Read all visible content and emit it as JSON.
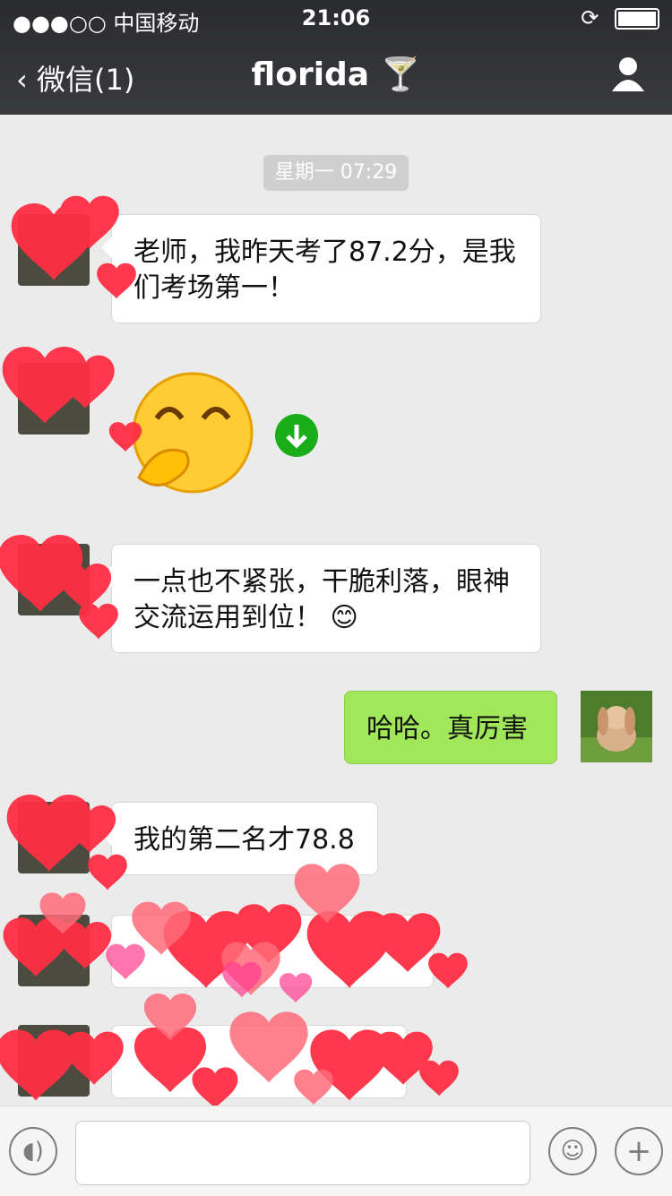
{
  "status_bar": {
    "carrier": "●●●○○ 中国移动",
    "time": "21:06"
  },
  "nav": {
    "back_label": "微信(1)",
    "title": "florida 🍸"
  },
  "chat": {
    "timestamp": "星期一 07:29",
    "messages": [
      {
        "side": "left",
        "text": "老师，我昨天考了87.2分，是我们考场第一！"
      },
      {
        "side": "left",
        "text": "一点也不紧张，干脆利落，眼神交流运用到位！ 😊"
      },
      {
        "side": "right",
        "text": "哈哈。真厉害"
      },
      {
        "side": "left",
        "text": "我的第二名才78.8"
      }
    ]
  },
  "colors": {
    "bg": "#ebebeb",
    "accent_green": "#a0e75a",
    "heart_red": "#ff3044",
    "download_green": "#1aad19"
  }
}
